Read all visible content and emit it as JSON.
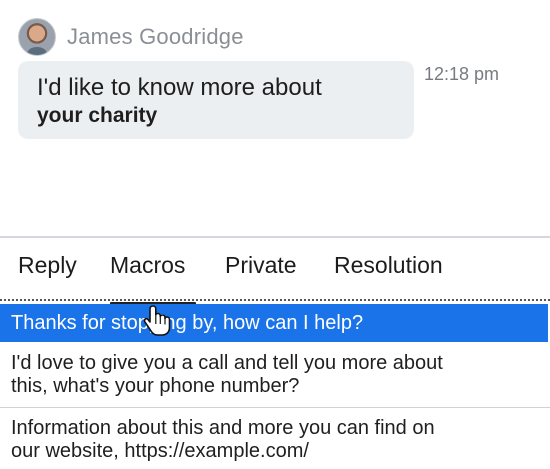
{
  "message": {
    "sender_name": "James Goodridge",
    "text_line1": "I'd like to know more about",
    "text_line2": "your charity",
    "time": "12:18 pm"
  },
  "tabs": [
    {
      "label": "Reply"
    },
    {
      "label": "Macros"
    },
    {
      "label": "Private"
    },
    {
      "label": "Resolution"
    }
  ],
  "active_tab": "Macros",
  "macros": [
    {
      "line1": "Thanks for stopping by, how can I help?",
      "selected": true
    },
    {
      "line1": "I'd love to give you a call and tell you more about",
      "line2": "this, what's your phone number?"
    },
    {
      "line1": "Information about this and more you can find on",
      "line2": "our website, https://example.com/"
    }
  ],
  "colors": {
    "selection": "#1a73e8",
    "bubble": "#eceff2",
    "muted_text": "#8a8f96"
  },
  "icons": {
    "avatar": "user-photo",
    "cursor": "hand-pointer-icon"
  }
}
